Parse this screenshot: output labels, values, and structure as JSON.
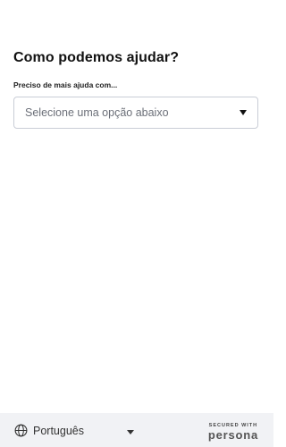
{
  "main": {
    "heading": "Como podemos ajudar?",
    "field_label": "Preciso de mais ajuda com...",
    "select": {
      "selected_value": "Selecione uma opção abaixo",
      "icon": "caret-down-icon"
    }
  },
  "footer": {
    "language": {
      "icon": "globe-icon",
      "label": "Português",
      "caret_icon": "caret-down-icon"
    },
    "secured_with": "SECURED WITH",
    "brand": "persona"
  },
  "colors": {
    "background": "#ffffff",
    "footer_background": "#f1f2f5",
    "border": "#c9cdd6",
    "placeholder_text": "#6b6f78"
  }
}
